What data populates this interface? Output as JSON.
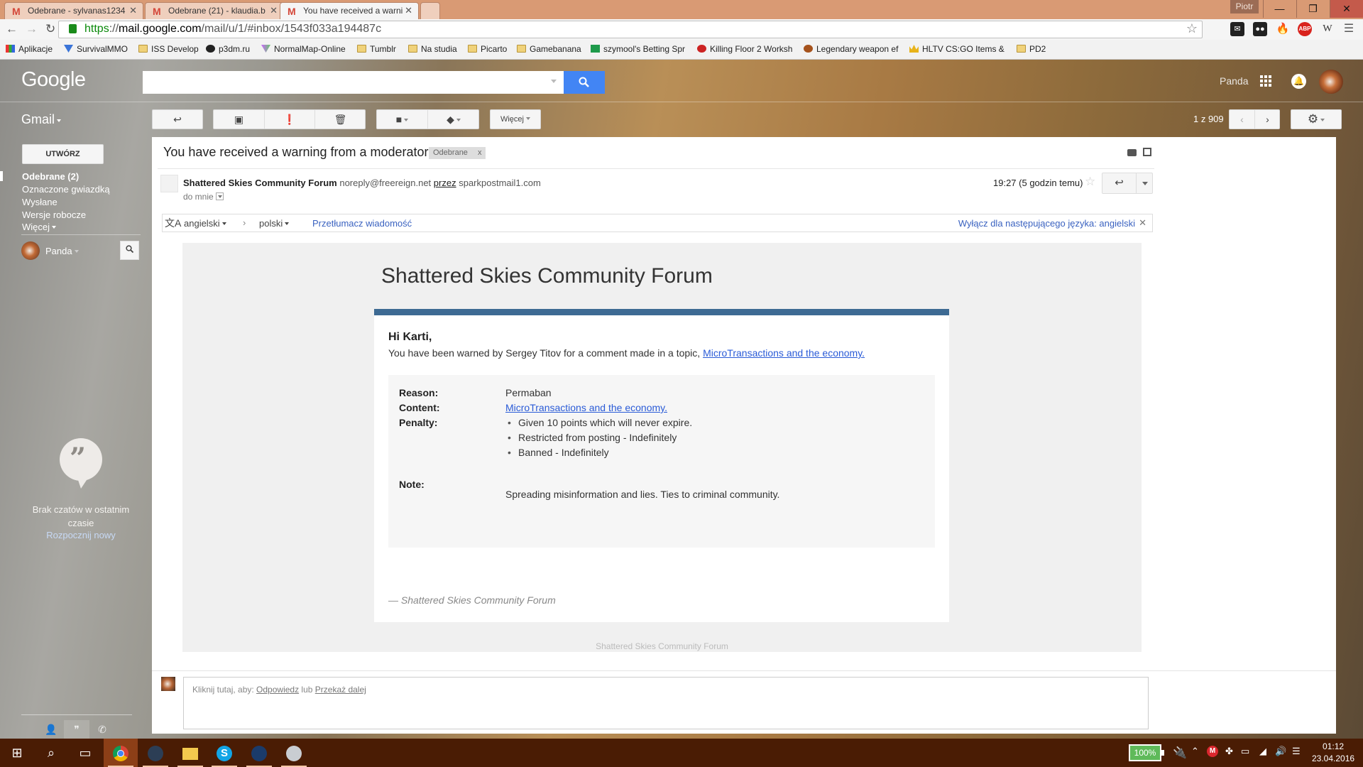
{
  "browser": {
    "tabs": [
      {
        "title": "Odebrane - sylvanas1234",
        "active": false
      },
      {
        "title": "Odebrane (21) - klaudia.b",
        "active": false
      },
      {
        "title": "You have received a warni",
        "active": true
      }
    ],
    "profile_name": "Piotr",
    "window_controls": {
      "minimize": "—",
      "restore": "❐",
      "close": "✕"
    },
    "url": {
      "scheme": "https",
      "rest_prefix": "://",
      "host": "mail.google.com",
      "path": "/mail/u/1/#inbox/1543f033a194487c"
    },
    "bookmarks": [
      {
        "label": "Aplikacje",
        "icon": "apps-icon"
      },
      {
        "label": "SurvivalMMO",
        "icon": "survivalmmo-icon"
      },
      {
        "label": "ISS Develop",
        "icon": "folder-icon"
      },
      {
        "label": "p3dm.ru",
        "icon": "p3dm-icon"
      },
      {
        "label": "NormalMap-Online",
        "icon": "normalmap-icon"
      },
      {
        "label": "Tumblr",
        "icon": "folder-icon"
      },
      {
        "label": "Na studia",
        "icon": "folder-icon"
      },
      {
        "label": "Picarto",
        "icon": "folder-icon"
      },
      {
        "label": "Gamebanana",
        "icon": "folder-icon"
      },
      {
        "label": "szymool's Betting Spr",
        "icon": "sheets-icon"
      },
      {
        "label": "Killing Floor 2 Worksh",
        "icon": "kf2-icon"
      },
      {
        "label": "Legendary weapon ef",
        "icon": "legendary-icon"
      },
      {
        "label": "HLTV CS:GO Items &",
        "icon": "crown-icon"
      },
      {
        "label": "PD2",
        "icon": "folder-icon"
      }
    ],
    "extensions": [
      "steam-new-icon",
      "ghostery-icon",
      "flame-icon",
      "adblock-plus-icon",
      "wikipedia-icon"
    ]
  },
  "gmail": {
    "logo": "Google",
    "search": {
      "placeholder": "",
      "value": ""
    },
    "user_name": "Panda",
    "app_label": "Gmail",
    "toolbar": {
      "more_label": "Więcej",
      "pager": "1 z 909"
    },
    "compose_label": "UTWÓRZ",
    "nav": [
      {
        "label": "Odebrane (2)",
        "bold": true
      },
      {
        "label": "Oznaczone gwiazdką"
      },
      {
        "label": "Wysłane"
      },
      {
        "label": "Wersje robocze"
      },
      {
        "label": "Więcej"
      }
    ],
    "chat": {
      "user": "Panda",
      "empty_text": "Brak czatów w ostatnim czasie",
      "start_link": "Rozpocznij nowy"
    }
  },
  "message": {
    "subject": "You have received a warning from a moderator",
    "label": "Odebrane",
    "label_remove": "x",
    "sender_name": "Shattered Skies Community Forum",
    "sender_email": "noreply@freereign.net",
    "via_label": "przez",
    "via_domain": "sparkpostmail1.com",
    "to_line": "do mnie",
    "date": "19:27 (5 godzin temu)",
    "translate": {
      "source_lang": "angielski",
      "target_lang": "polski",
      "translate_link": "Przetłumacz wiadomość",
      "disable_link": "Wyłącz dla następującego języka: angielski"
    },
    "body": {
      "forum_title": "Shattered Skies Community Forum",
      "greeting": "Hi Karti,",
      "intro_text": "You have been warned by Sergey Titov for a comment made in a topic, ",
      "intro_link": "MicroTransactions and the economy.",
      "reason_label": "Reason:",
      "reason_value": "Permaban",
      "content_label": "Content:",
      "content_link": "MicroTransactions and the economy.",
      "penalty_label": "Penalty:",
      "penalties": [
        "Given 10 points which will never expire.",
        "Restricted from posting - Indefinitely",
        "Banned - Indefinitely"
      ],
      "note_label": "Note:",
      "note_value": "Spreading misinformation and lies. Ties to criminal community.",
      "signoff": "— Shattered Skies Community Forum",
      "footer": "Shattered Skies Community Forum",
      "accent_color": "#3d6a93"
    },
    "reply": {
      "prompt": "Kliknij tutaj, aby: ",
      "reply_link": "Odpowiedz",
      "or": " lub ",
      "forward_link": "Przekaż dalej"
    }
  },
  "taskbar": {
    "apps": [
      "windows-start-icon",
      "search-icon",
      "task-view-icon",
      "chrome-icon",
      "teamspeak-icon",
      "file-explorer-icon",
      "skype-icon",
      "steam-icon",
      "volume-app-icon"
    ],
    "battery": "100%",
    "time": "01:12",
    "date": "23.04.2016"
  }
}
